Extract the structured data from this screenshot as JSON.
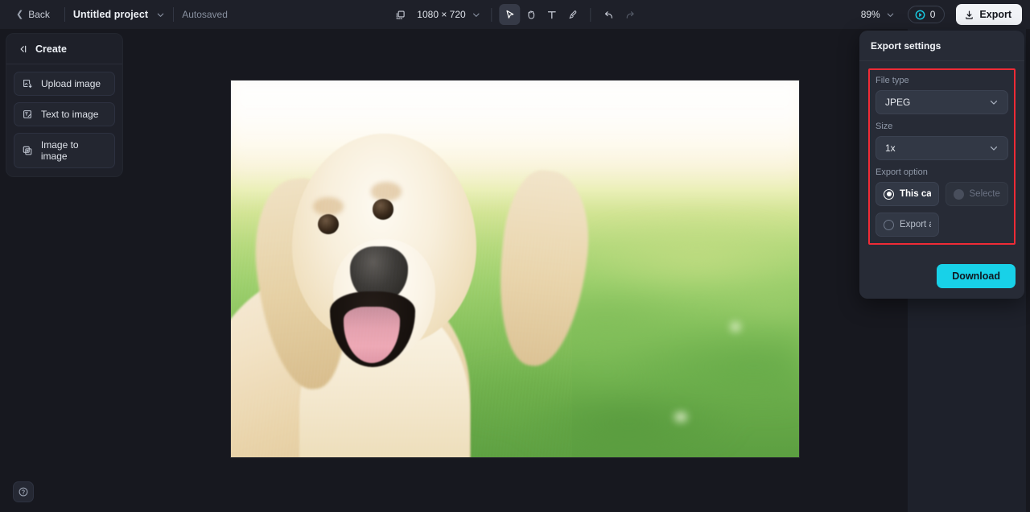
{
  "topbar": {
    "back_label": "Back",
    "project_name": "Untitled project",
    "autosaved_label": "Autosaved",
    "canvas_dimensions": "1080 × 720",
    "zoom_level": "89%",
    "credits_count": "0",
    "export_label": "Export",
    "tools": [
      {
        "name": "select-tool",
        "active": true
      },
      {
        "name": "hand-tool",
        "active": false
      },
      {
        "name": "text-tool",
        "active": false
      },
      {
        "name": "brush-tool",
        "active": false
      }
    ],
    "history": {
      "undo": "Undo",
      "redo": "Redo"
    }
  },
  "sidebar": {
    "header_label": "Create",
    "items": [
      {
        "label": "Upload image",
        "icon": "upload-image-icon"
      },
      {
        "label": "Text to image",
        "icon": "text-to-image-icon"
      },
      {
        "label": "Image to image",
        "icon": "image-to-image-icon"
      }
    ],
    "help_label": "?"
  },
  "export_settings": {
    "title": "Export settings",
    "file_type": {
      "label": "File type",
      "value": "JPEG"
    },
    "size": {
      "label": "Size",
      "value": "1x"
    },
    "export_option": {
      "label": "Export option",
      "options": [
        {
          "label": "This canvas",
          "selected": true,
          "disabled": false
        },
        {
          "label": "Selected l...",
          "selected": false,
          "disabled": true
        },
        {
          "label": "Export all ...",
          "selected": false,
          "disabled": false
        }
      ]
    },
    "download_label": "Download",
    "highlight_color": "#ef2b36",
    "accent_color": "#18d1e8"
  },
  "canvas": {
    "image_alt": "golden-retriever-puppy-on-grass"
  }
}
